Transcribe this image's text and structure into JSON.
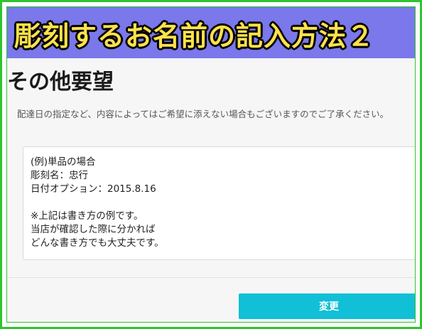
{
  "banner": {
    "title": "彫刻するお名前の記入方法２"
  },
  "section": {
    "title": "その他要望",
    "description": "配達日の指定など、内容によってはご希望に添えない場合もございますのでご了承ください。"
  },
  "request_field": {
    "lines": [
      "(例)単品の場合",
      "彫刻名：忠行",
      "日付オプション：2015.8.16",
      "",
      "※上記は書き方の例です。",
      "当店が確認した際に分かれば",
      "どんな書き方でも大丈夫です。"
    ]
  },
  "actions": {
    "change_label": "変更"
  },
  "colors": {
    "frame": "#2ec52e",
    "banner_bg": "#7a78ea",
    "banner_text": "#ffe24a",
    "button": "#11bfd6"
  }
}
